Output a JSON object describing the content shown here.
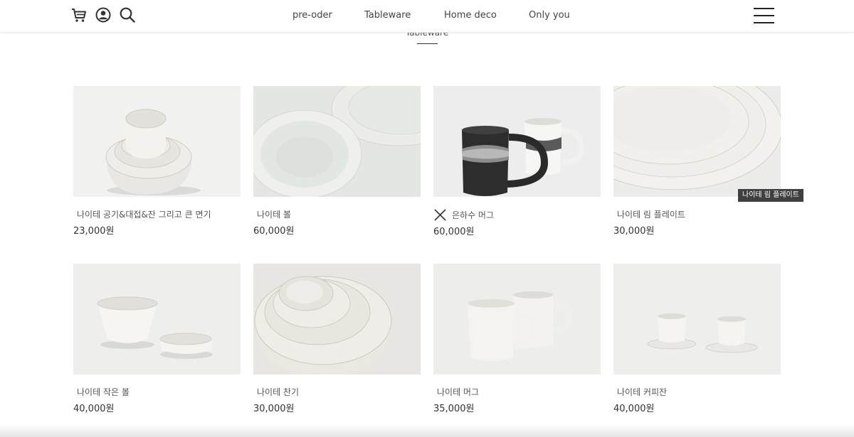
{
  "nav": {
    "icons": [
      "cart-icon",
      "user-icon",
      "search-icon"
    ],
    "links": [
      "pre-oder",
      "Tableware",
      "Home deco",
      "Only you"
    ],
    "menu_icon": "hamburger-menu-icon"
  },
  "category": {
    "title": "Tableware"
  },
  "products": [
    {
      "name": "나이테 공기&대접&잔 그리고 큰 면기",
      "price": "23,000원"
    },
    {
      "name": "나이테 볼",
      "price": "60,000원"
    },
    {
      "name": "은하수 머그",
      "price": "60,000원"
    },
    {
      "name": "나이테 림 플레이트",
      "price": "30,000원"
    },
    {
      "name": "나이테 작은 볼",
      "price": "40,000원"
    },
    {
      "name": "나이테 찬기",
      "price": "30,000원"
    },
    {
      "name": "나이테 머그",
      "price": "35,000원"
    },
    {
      "name": "나이테 커피잔",
      "price": "40,000원"
    }
  ],
  "tooltip": {
    "text": "나이테 림 플레이트"
  }
}
